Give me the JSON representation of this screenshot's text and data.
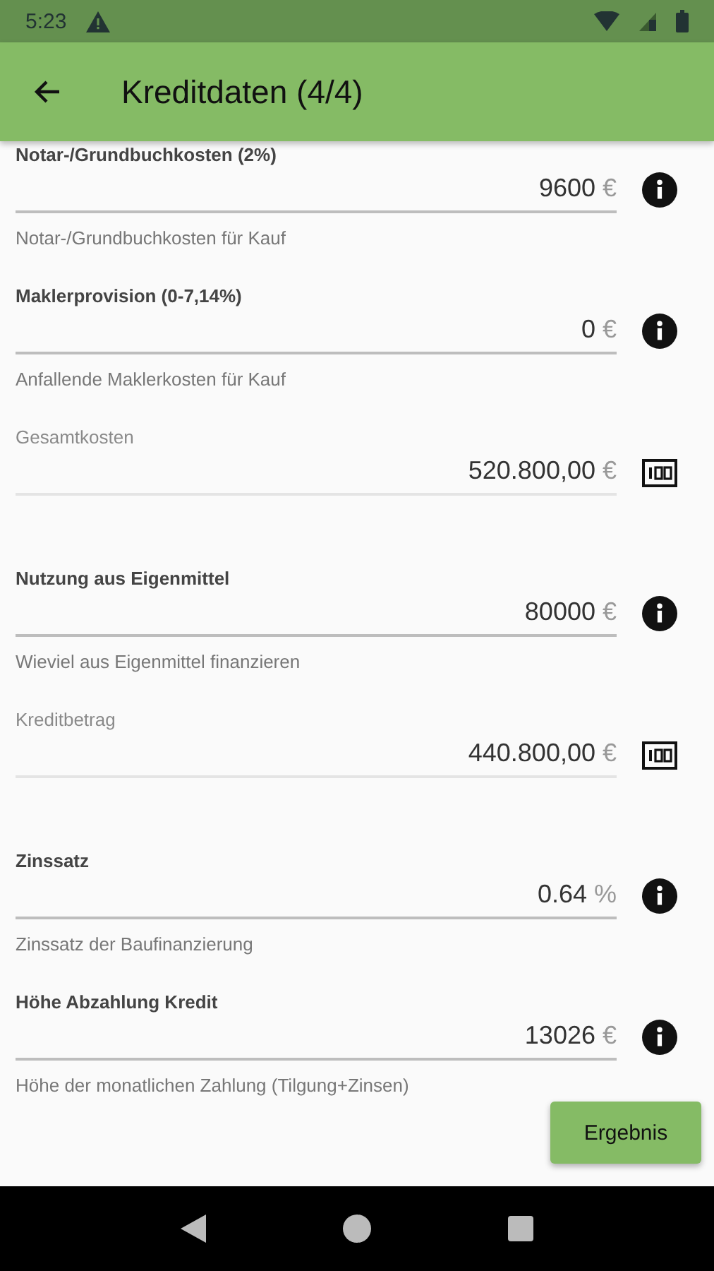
{
  "status_bar": {
    "time": "5:23"
  },
  "app_bar": {
    "title": "Kreditdaten (4/4)"
  },
  "fields": [
    {
      "kind": "input",
      "label": "Notar-/Grundbuchkosten (2%)",
      "value": "9600",
      "unit": "€",
      "helper": "Notar-/Grundbuchkosten für Kauf"
    },
    {
      "kind": "input",
      "label": "Maklerprovision (0-7,14%)",
      "value": "0",
      "unit": "€",
      "helper": "Anfallende Maklerkosten für Kauf"
    },
    {
      "kind": "computed",
      "label": "Gesamtkosten",
      "value": "520.800,00",
      "unit": "€"
    },
    {
      "kind": "input",
      "label": "Nutzung aus Eigenmittel",
      "value": "80000",
      "unit": "€",
      "helper": "Wieviel aus Eigenmittel finanzieren"
    },
    {
      "kind": "computed",
      "label": "Kreditbetrag",
      "value": "440.800,00",
      "unit": "€"
    },
    {
      "kind": "input",
      "label": "Zinssatz",
      "value": "0.64",
      "unit": "%",
      "helper": "Zinssatz der Baufinanzierung"
    },
    {
      "kind": "input",
      "label": "Höhe Abzahlung Kredit",
      "value": "13026",
      "unit": "€",
      "helper": "Höhe der monatlichen Zahlung (Tilgung+Zinsen)"
    }
  ],
  "button": {
    "label": "Ergebnis"
  }
}
